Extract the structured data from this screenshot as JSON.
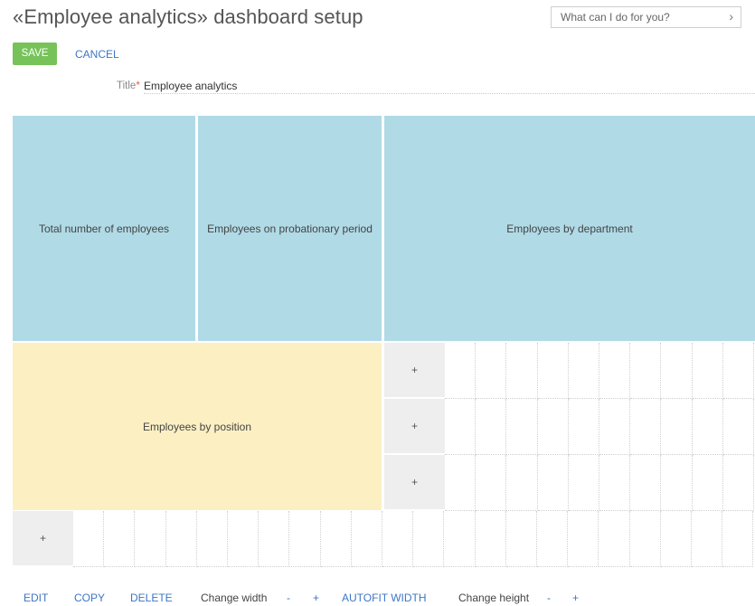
{
  "header": {
    "title": "«Employee analytics» dashboard setup",
    "search_placeholder": "What can I do for you?"
  },
  "toolbar": {
    "save_label": "SAVE",
    "cancel_label": "CANCEL"
  },
  "form": {
    "title_label": "Title",
    "required_mark": "*",
    "title_value": "Employee analytics"
  },
  "widgets": [
    {
      "label": "Total number of employees"
    },
    {
      "label": "Employees on probationary period"
    },
    {
      "label": "Employees by department"
    },
    {
      "label": "Employees by position"
    }
  ],
  "grid": {
    "add_label": "+"
  },
  "footer": {
    "edit": "EDIT",
    "copy": "COPY",
    "delete": "DELETE",
    "change_width": "Change width",
    "width_minus": "-",
    "width_plus": "+",
    "autofit": "AUTOFIT WIDTH",
    "change_height": "Change height",
    "height_minus": "-",
    "height_plus": "+"
  },
  "colors": {
    "widget_blue": "#b0dae6",
    "widget_yellow": "#fcf0c3",
    "save_green": "#77c35a",
    "link_blue": "#3d76c6"
  }
}
